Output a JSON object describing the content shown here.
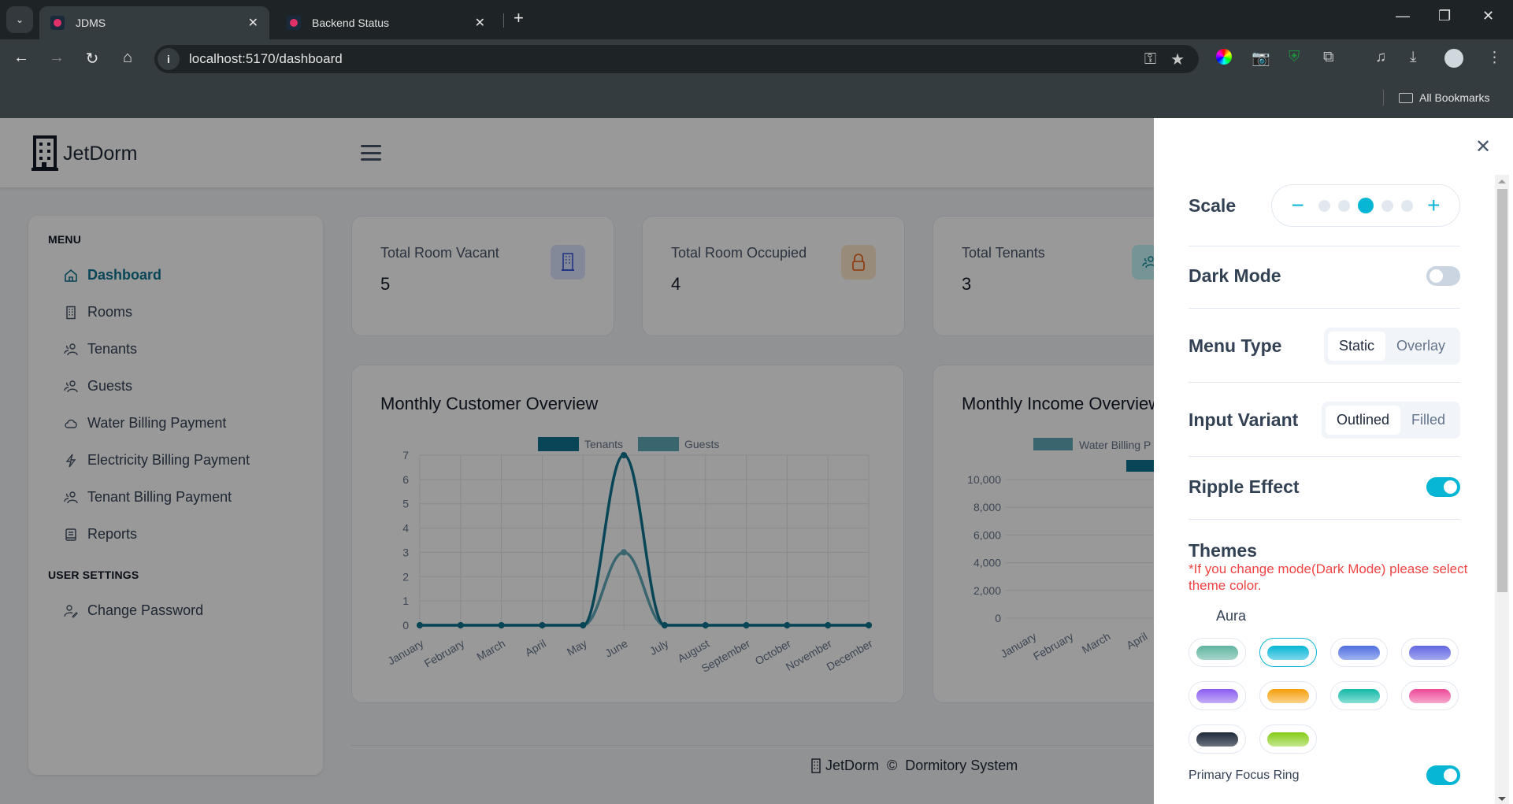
{
  "browser": {
    "tabs": [
      {
        "title": "JDMS",
        "active": true
      },
      {
        "title": "Backend Status",
        "active": false
      }
    ],
    "new_tab_label": "+",
    "url": "localhost:5170/dashboard",
    "bookmarks_label": "All Bookmarks"
  },
  "app": {
    "name": "JetDorm",
    "accent": "#0e7490"
  },
  "sidebar": {
    "sections": [
      {
        "title": "MENU",
        "items": [
          {
            "label": "Dashboard",
            "icon": "home-icon",
            "active": true
          },
          {
            "label": "Rooms",
            "icon": "building-icon"
          },
          {
            "label": "Tenants",
            "icon": "users-icon"
          },
          {
            "label": "Guests",
            "icon": "users-icon"
          },
          {
            "label": "Water Billing Payment",
            "icon": "cloud-icon"
          },
          {
            "label": "Electricity Billing Payment",
            "icon": "bolt-icon"
          },
          {
            "label": "Tenant Billing Payment",
            "icon": "users-icon"
          },
          {
            "label": "Reports",
            "icon": "book-icon"
          }
        ]
      },
      {
        "title": "USER SETTINGS",
        "items": [
          {
            "label": "Change Password",
            "icon": "user-edit-icon"
          }
        ]
      }
    ]
  },
  "stats": [
    {
      "label": "Total Room Vacant",
      "value": "5",
      "icon": "building-icon",
      "color": "#3b5bdb"
    },
    {
      "label": "Total Room Occupied",
      "value": "4",
      "icon": "lock-icon",
      "color": "#e8590c"
    },
    {
      "label": "Total Tenants",
      "value": "3",
      "icon": "users-icon",
      "color": "#0c8599"
    }
  ],
  "chart_data": [
    {
      "type": "line",
      "title": "Monthly Customer Overview",
      "categories": [
        "January",
        "February",
        "March",
        "April",
        "May",
        "June",
        "July",
        "August",
        "September",
        "October",
        "November",
        "December"
      ],
      "series": [
        {
          "name": "Tenants",
          "color": "#0e7490",
          "values": [
            0,
            0,
            0,
            0,
            0,
            7,
            0,
            0,
            0,
            0,
            0,
            0
          ]
        },
        {
          "name": "Guests",
          "color": "#5fa8b8",
          "values": [
            0,
            0,
            0,
            0,
            0,
            3,
            0,
            0,
            0,
            0,
            0,
            0
          ]
        }
      ],
      "yticks": [
        0,
        1,
        2,
        3,
        4,
        5,
        6,
        7
      ],
      "ylim": [
        0,
        7
      ],
      "grid": true,
      "legend": "top"
    },
    {
      "type": "bar",
      "title": "Monthly Income Overview",
      "categories": [
        "January",
        "February",
        "March",
        "April"
      ],
      "series": [
        {
          "name": "Water Billing P",
          "color": "#5fa8b8",
          "values": []
        },
        {
          "name": "",
          "color": "#0e7490",
          "values": []
        }
      ],
      "yticks": [
        "0",
        "2,000",
        "4,000",
        "6,000",
        "8,000",
        "10,000"
      ],
      "ylim": [
        0,
        10000
      ],
      "grid": true,
      "legend": "top"
    }
  ],
  "footer": {
    "brand": "JetDorm",
    "copyright": "©",
    "text": "Dormitory System"
  },
  "config_panel": {
    "scale": {
      "label": "Scale",
      "levels": 5,
      "current": 3,
      "minus": "−",
      "plus": "+"
    },
    "dark_mode": {
      "label": "Dark Mode",
      "on": false
    },
    "menu_type": {
      "label": "Menu Type",
      "options": [
        "Static",
        "Overlay"
      ],
      "selected": "Static"
    },
    "input_variant": {
      "label": "Input Variant",
      "options": [
        "Outlined",
        "Filled"
      ],
      "selected": "Outlined"
    },
    "ripple": {
      "label": "Ripple Effect",
      "on": true
    },
    "themes": {
      "title": "Themes",
      "note": "*If you change mode(Dark Mode) please select theme color.",
      "preset": "Aura",
      "colors": [
        {
          "name": "noir-green",
          "from": "#5fb3a0",
          "to": "#a7d6cb"
        },
        {
          "name": "cyan",
          "from": "#06b6d4",
          "to": "#7dd8ec",
          "selected": true
        },
        {
          "name": "blue",
          "from": "#4f6fe0",
          "to": "#9fb3f0"
        },
        {
          "name": "indigo",
          "from": "#6366e0",
          "to": "#a5a8f0"
        },
        {
          "name": "purple",
          "from": "#8b5cf0",
          "to": "#c4adf7"
        },
        {
          "name": "amber",
          "from": "#f59e0b",
          "to": "#fbd38a"
        },
        {
          "name": "teal",
          "from": "#14b8a6",
          "to": "#86e0d6"
        },
        {
          "name": "pink",
          "from": "#ec4899",
          "to": "#f7a8cc"
        },
        {
          "name": "noir",
          "from": "#1f2937",
          "to": "#6b7280"
        },
        {
          "name": "lime",
          "from": "#84cc16",
          "to": "#c5e78e"
        }
      ]
    },
    "primary_focus_ring": {
      "label": "Primary Focus Ring",
      "on": true
    }
  }
}
